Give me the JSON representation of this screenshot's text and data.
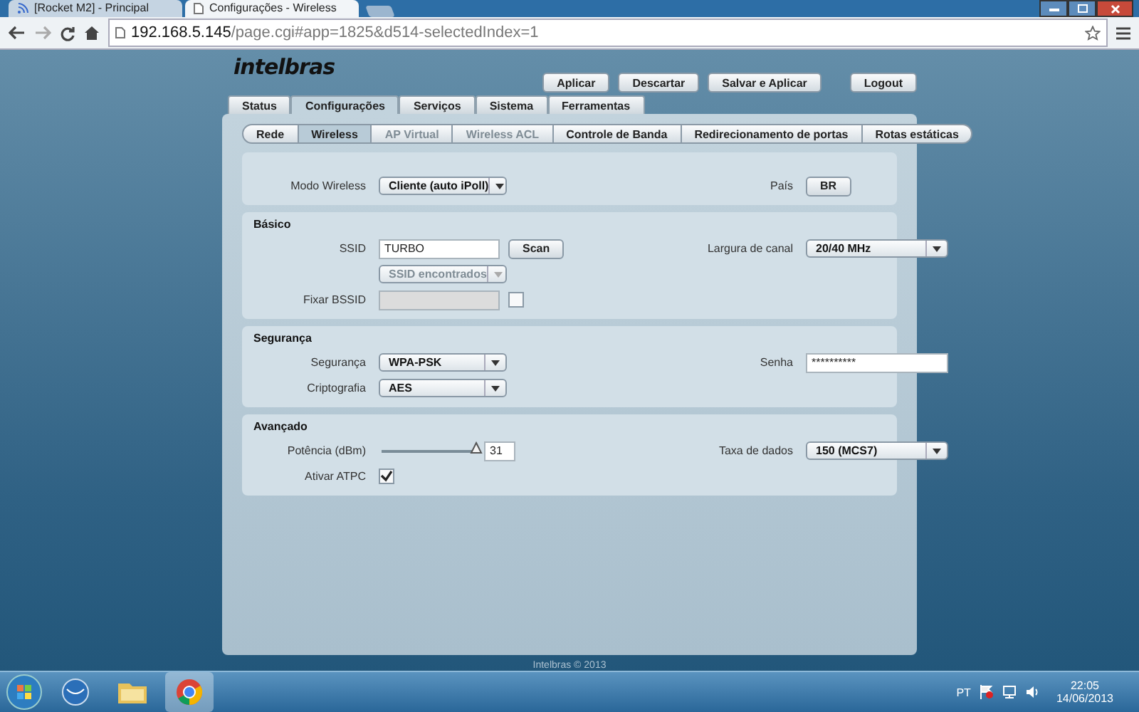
{
  "browser": {
    "tabs": [
      {
        "kind": "feed",
        "title": "[Rocket M2] - Principal",
        "selected": false
      },
      {
        "kind": "page",
        "title": "Configurações - Wireless",
        "selected": true
      }
    ],
    "url": {
      "host": "192.168.5.145",
      "path": "/page.cgi#app=1825&d514-selectedIndex=1"
    }
  },
  "logo": "intelbras",
  "actions": [
    "Aplicar",
    "Descartar",
    "Salvar e Aplicar"
  ],
  "logout": "Logout",
  "main_tabs": [
    {
      "label": "Status",
      "selected": false
    },
    {
      "label": "Configurações",
      "selected": true
    },
    {
      "label": "Serviços",
      "selected": false
    },
    {
      "label": "Sistema",
      "selected": false
    },
    {
      "label": "Ferramentas",
      "selected": false
    }
  ],
  "sub_tabs": [
    {
      "label": "Rede",
      "selected": false,
      "disabled": false
    },
    {
      "label": "Wireless",
      "selected": true,
      "disabled": false
    },
    {
      "label": "AP Virtual",
      "selected": false,
      "disabled": true
    },
    {
      "label": "Wireless ACL",
      "selected": false,
      "disabled": true
    },
    {
      "label": "Controle de Banda",
      "selected": false,
      "disabled": false
    },
    {
      "label": "Redirecionamento de portas",
      "selected": false,
      "disabled": false
    },
    {
      "label": "Rotas estáticas",
      "selected": false,
      "disabled": false
    }
  ],
  "sections": [
    {
      "rows": [
        {
          "left": {
            "label": "Modo Wireless",
            "controls": [
              {
                "kind": "select",
                "value": "Cliente (auto iPoll)",
                "disabled": false
              }
            ]
          },
          "right": {
            "label": "País",
            "controls": [
              {
                "kind": "button",
                "label": "BR"
              }
            ]
          }
        }
      ]
    },
    {
      "title": "Básico",
      "rows": [
        {
          "left": {
            "label": "SSID",
            "controls": [
              {
                "kind": "text",
                "value": "TURBO",
                "disabled": false
              },
              {
                "kind": "button",
                "label": "Scan"
              }
            ]
          },
          "right": {
            "label": "Largura de canal",
            "controls": [
              {
                "kind": "select",
                "value": "20/40 MHz",
                "disabled": false
              }
            ]
          }
        },
        {
          "left": {
            "controls": [
              {
                "kind": "select",
                "value": "SSID encontrados",
                "disabled": true
              }
            ]
          }
        },
        {
          "left": {
            "label": "Fixar BSSID",
            "controls": [
              {
                "kind": "text",
                "disabled": true
              },
              {
                "kind": "checkbox",
                "checked": false
              }
            ]
          }
        }
      ]
    },
    {
      "title": "Segurança",
      "rows": [
        {
          "left": {
            "label": "Segurança",
            "controls": [
              {
                "kind": "select",
                "value": "WPA-PSK",
                "disabled": false
              }
            ]
          },
          "right": {
            "label": "Senha",
            "controls": [
              {
                "kind": "text",
                "value": "**********",
                "disabled": false
              }
            ]
          }
        },
        {
          "left": {
            "label": "Criptografia",
            "controls": [
              {
                "kind": "select",
                "value": "AES",
                "disabled": false
              }
            ]
          }
        }
      ]
    },
    {
      "title": "Avançado",
      "rows": [
        {
          "left": {
            "label": "Potência (dBm)",
            "controls": [
              {
                "kind": "slider",
                "level": 1
              },
              {
                "kind": "number",
                "value": "31"
              }
            ]
          },
          "right": {
            "label": "Taxa de dados",
            "controls": [
              {
                "kind": "select",
                "value": "150 (MCS7)",
                "disabled": false
              }
            ]
          }
        },
        {
          "left": {
            "label": "Ativar ATPC",
            "controls": [
              {
                "kind": "checkbox",
                "checked": true
              }
            ]
          }
        }
      ]
    }
  ],
  "footer": "Intelbras © 2013",
  "taskbar": {
    "apps": [
      {
        "kind": "globe",
        "selected": false
      },
      {
        "kind": "folder",
        "selected": false
      },
      {
        "kind": "browser",
        "selected": true
      }
    ],
    "language": "PT",
    "time": "22:05",
    "date": "14/06/2013"
  }
}
